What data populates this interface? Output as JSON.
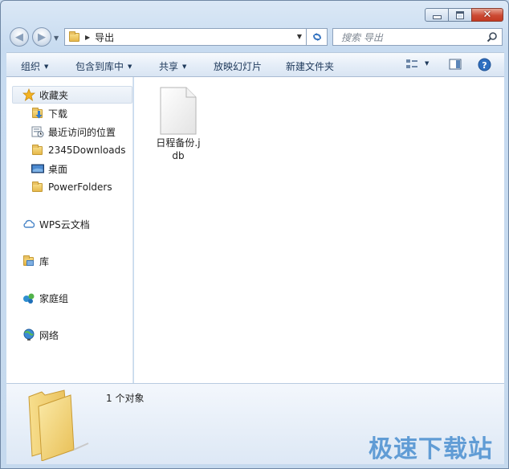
{
  "nav": {
    "path": [
      "导出"
    ],
    "search_placeholder": "搜索 导出"
  },
  "toolbar": {
    "organize": "组织",
    "include_in_library": "包含到库中",
    "share": "共享",
    "slideshow": "放映幻灯片",
    "new_folder": "新建文件夹"
  },
  "sidebar": {
    "favorites": {
      "label": "收藏夹",
      "items": [
        {
          "label": "下载",
          "icon": "download-folder-icon"
        },
        {
          "label": "最近访问的位置",
          "icon": "recent-places-icon"
        },
        {
          "label": "2345Downloads",
          "icon": "folder-icon"
        },
        {
          "label": "桌面",
          "icon": "desktop-icon"
        },
        {
          "label": "PowerFolders",
          "icon": "folder-icon"
        }
      ]
    },
    "wps": "WPS云文档",
    "libraries": "库",
    "homegroup": "家庭组",
    "network": "网络"
  },
  "files": [
    {
      "name": "日程备份.jdb",
      "icon": "document-icon"
    }
  ],
  "status": {
    "count": "1 个对象"
  },
  "watermark": "极速下载站",
  "colors": {
    "accent": "#3a77c2",
    "close": "#c33a22",
    "folder": "#e6b84a"
  }
}
